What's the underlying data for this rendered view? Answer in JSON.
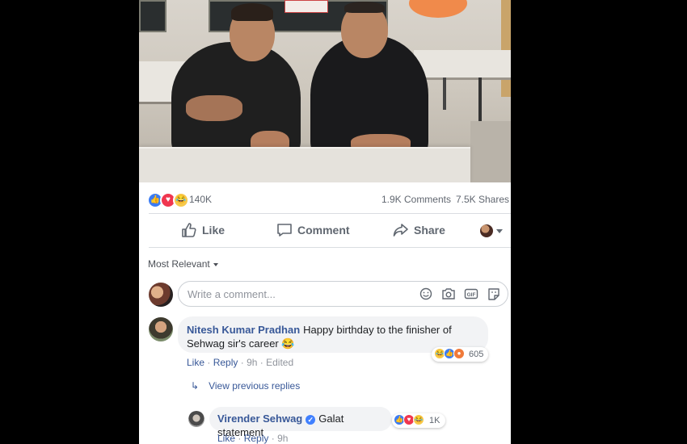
{
  "post": {
    "photo_alt_icon": "photo",
    "reactions": {
      "types": [
        "like",
        "love",
        "haha"
      ],
      "count": "140K",
      "comments": "1.9K Comments",
      "shares": "7.5K Shares"
    },
    "actions": {
      "like": "Like",
      "comment": "Comment",
      "share": "Share"
    },
    "sort_label": "Most Relevant",
    "composer": {
      "placeholder": "Write a comment...",
      "icons": [
        "emoji-icon",
        "camera-icon",
        "gif-icon",
        "sticker-icon"
      ]
    },
    "comments": [
      {
        "author": "Nitesh Kumar Pradhan",
        "text": "Happy birthday to the finisher of Sehwag sir's career 😂",
        "reaction_count": "605",
        "reaction_types": [
          "haha",
          "like",
          "angry"
        ],
        "like": "Like",
        "reply": "Reply",
        "time": "9h",
        "edited": "Edited",
        "view_previous": "View previous replies",
        "reply_item": {
          "author": "Virender Sehwag",
          "verified": true,
          "text": "Galat statement",
          "reaction_count": "1K",
          "reaction_types": [
            "like",
            "love",
            "haha"
          ],
          "like": "Like",
          "reply": "Reply",
          "time": "9h"
        }
      }
    ]
  },
  "colors": {
    "link": "#385898",
    "muted": "#90949c",
    "like_blue": "#3b7cf4",
    "love_red": "#f0364f",
    "haha_yellow": "#f7c94b"
  }
}
